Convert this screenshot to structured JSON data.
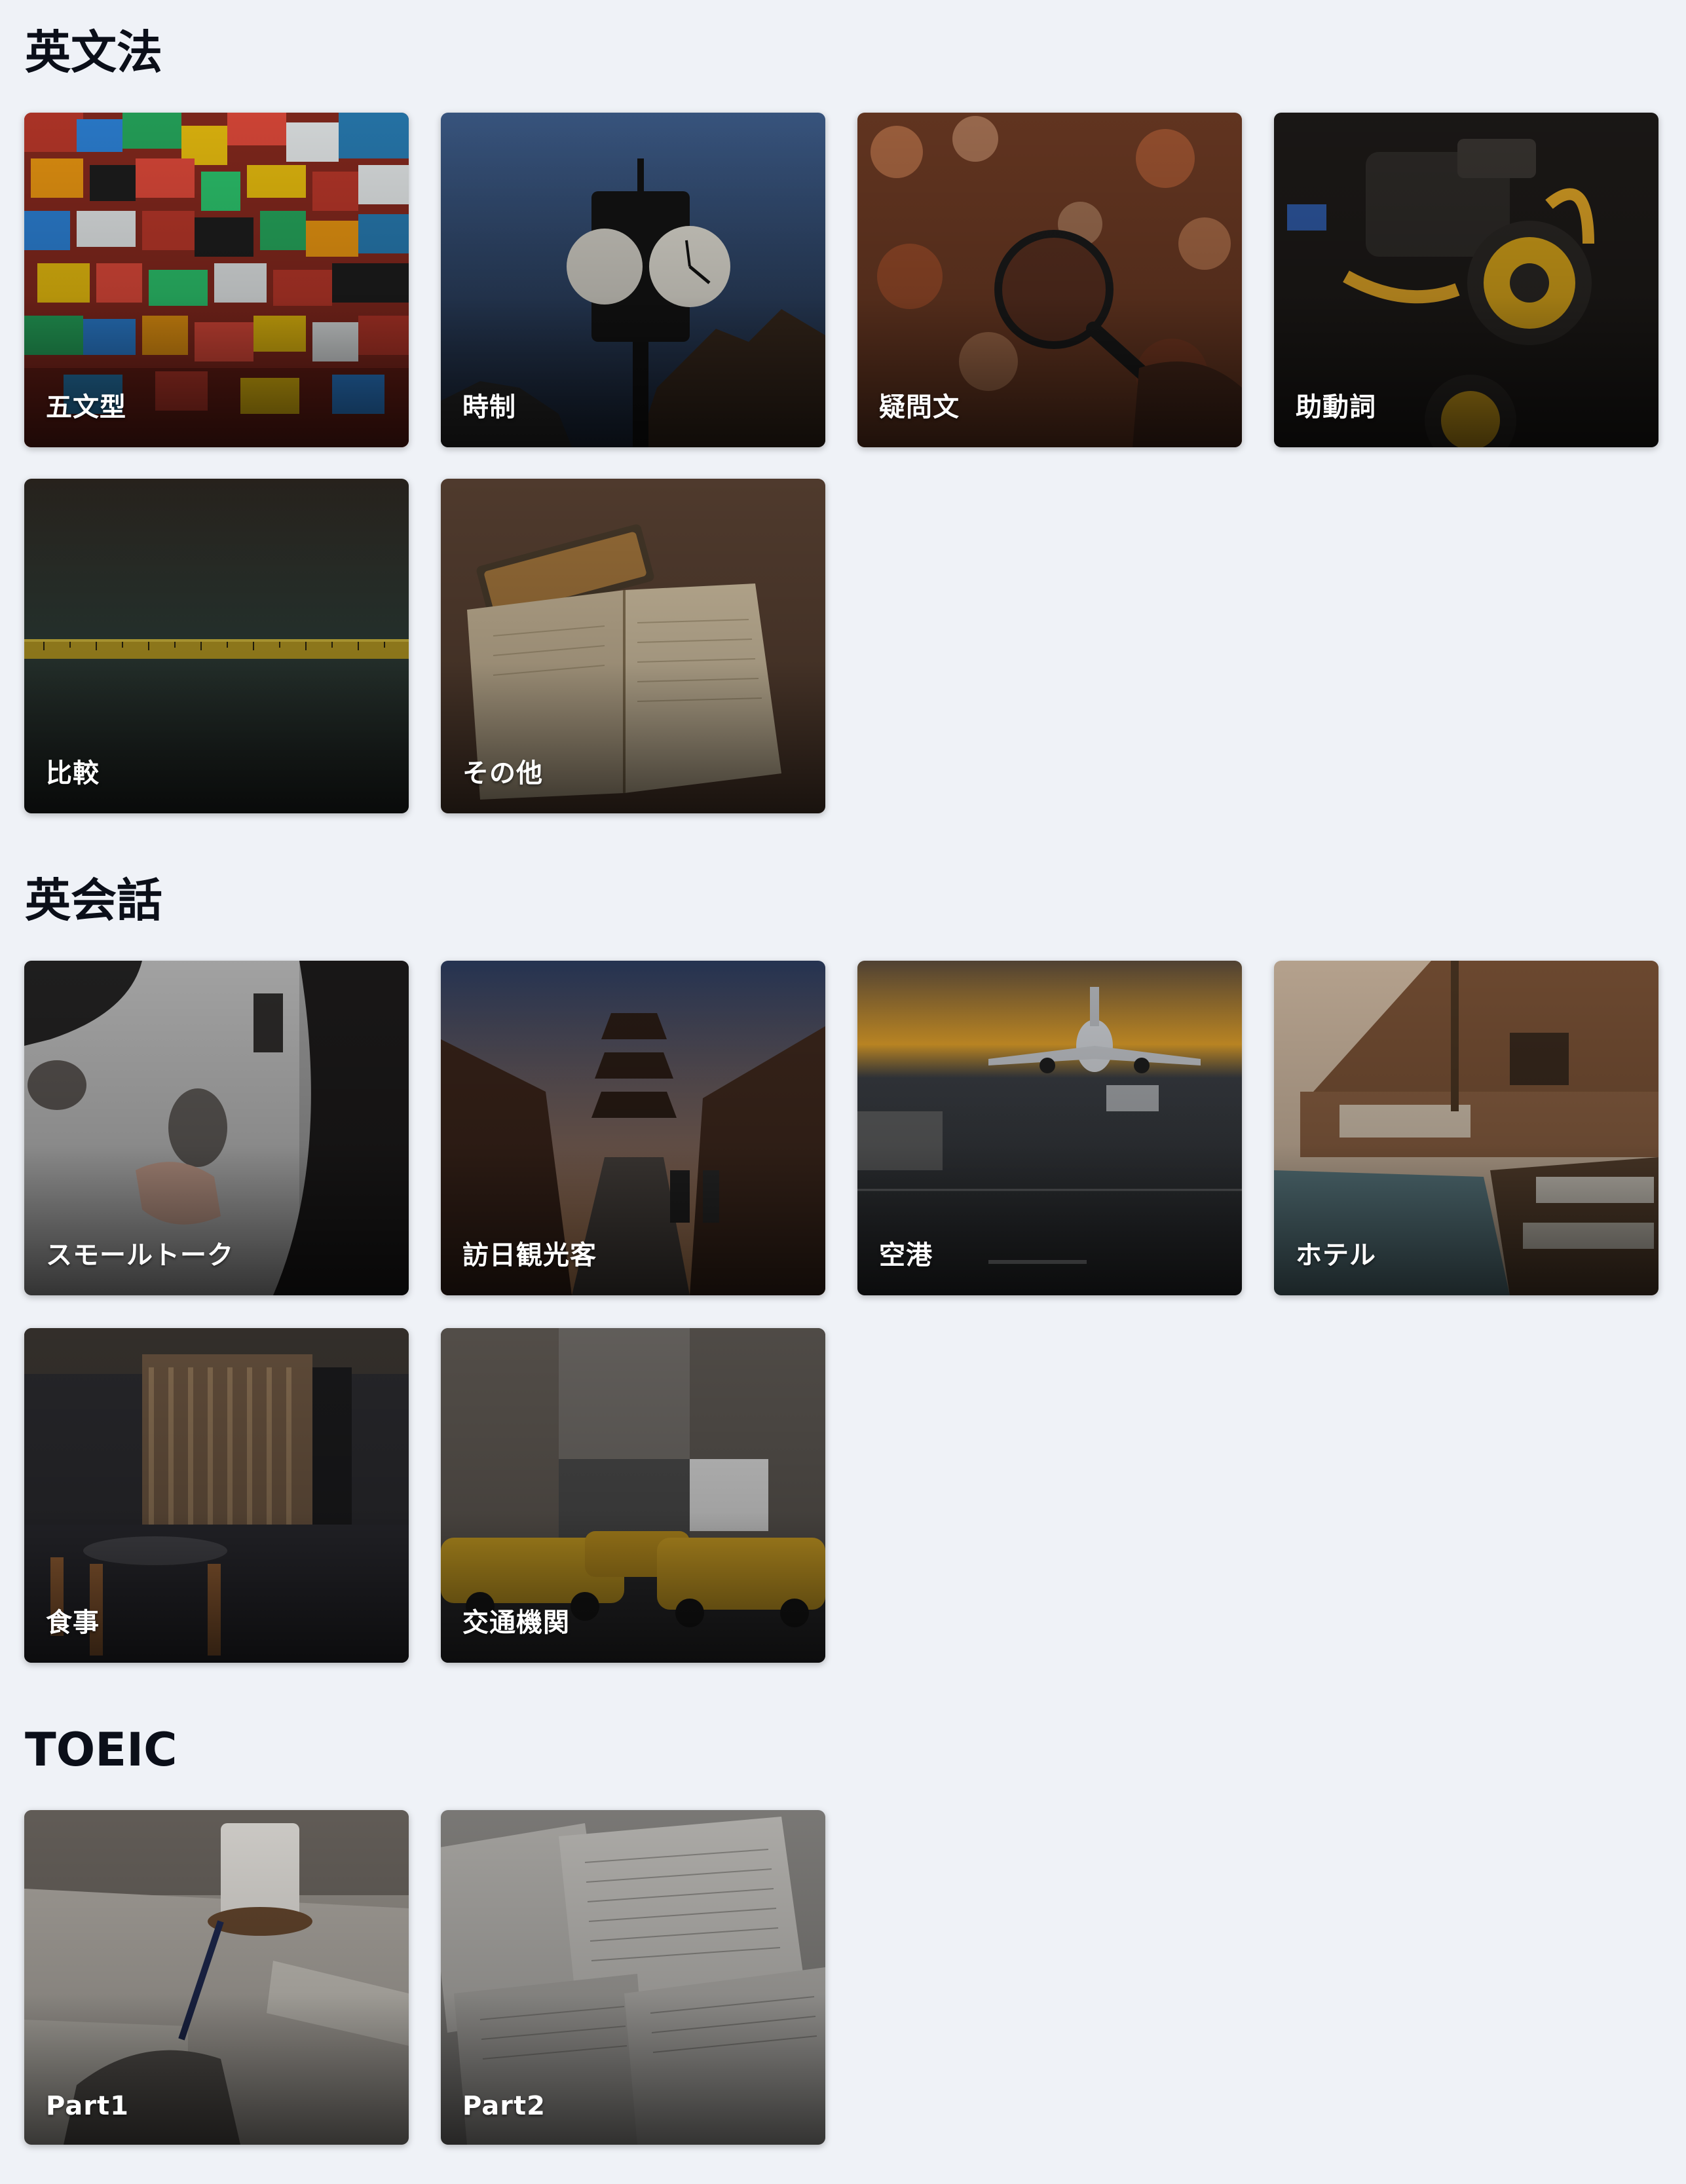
{
  "sections": [
    {
      "title": "英文法",
      "cards": [
        {
          "label": "五文型",
          "image": "lego-bricks"
        },
        {
          "label": "時制",
          "image": "street-clock"
        },
        {
          "label": "疑問文",
          "image": "magnifying-glass"
        },
        {
          "label": "助動詞",
          "image": "engine"
        },
        {
          "label": "比較",
          "image": "measuring-tape"
        },
        {
          "label": "その他",
          "image": "open-book"
        }
      ]
    },
    {
      "title": "英会話",
      "cards": [
        {
          "label": "スモールトーク",
          "image": "coffee-table"
        },
        {
          "label": "訪日観光客",
          "image": "kyoto-street"
        },
        {
          "label": "空港",
          "image": "airport-runway"
        },
        {
          "label": "ホテル",
          "image": "resort-pool"
        },
        {
          "label": "食事",
          "image": "restaurant"
        },
        {
          "label": "交通機関",
          "image": "taxi-street"
        }
      ]
    },
    {
      "title": "TOEIC",
      "cards": [
        {
          "label": "Part1",
          "image": "writing-desk"
        },
        {
          "label": "Part2",
          "image": "scattered-papers"
        }
      ]
    }
  ]
}
